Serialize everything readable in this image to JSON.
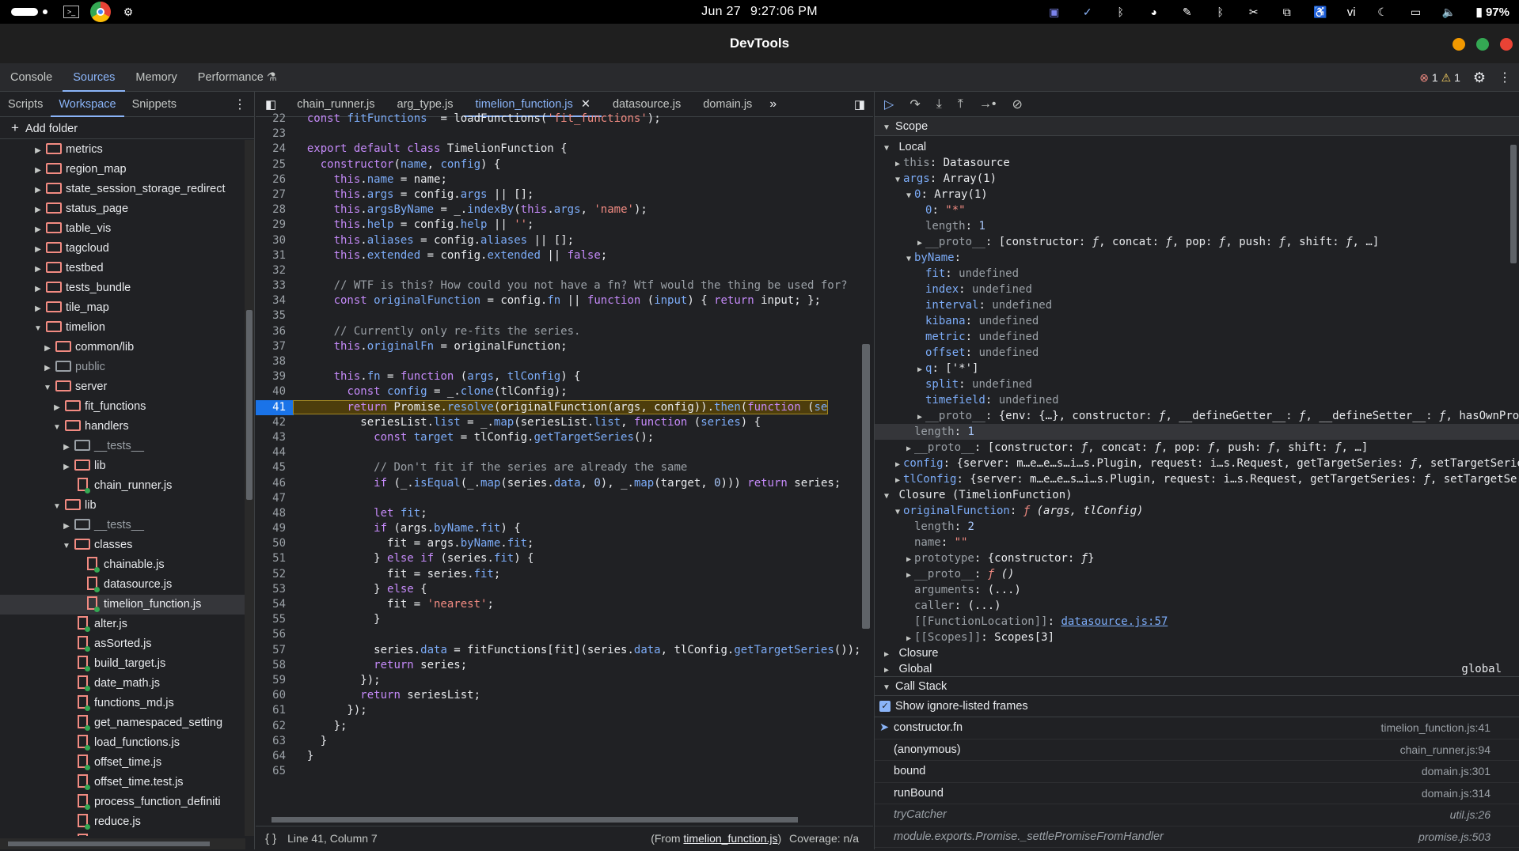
{
  "system": {
    "date": "Jun 27",
    "time": "9:27:06 PM",
    "battery": "97%",
    "lang": "vi"
  },
  "window": {
    "title": "DevTools"
  },
  "main_tabs": [
    "Console",
    "Sources",
    "Memory",
    "Performance"
  ],
  "issues": {
    "errors": "1",
    "warnings": "1"
  },
  "nav": {
    "tabs": [
      "Scripts",
      "Workspace",
      "Snippets"
    ],
    "add_folder": "Add folder",
    "tree": [
      {
        "label": "metrics",
        "type": "folder",
        "depth": 3,
        "open": false
      },
      {
        "label": "region_map",
        "type": "folder",
        "depth": 3,
        "open": false
      },
      {
        "label": "state_session_storage_redirect",
        "type": "folder",
        "depth": 3,
        "open": false
      },
      {
        "label": "status_page",
        "type": "folder",
        "depth": 3,
        "open": false
      },
      {
        "label": "table_vis",
        "type": "folder",
        "depth": 3,
        "open": false
      },
      {
        "label": "tagcloud",
        "type": "folder",
        "depth": 3,
        "open": false
      },
      {
        "label": "testbed",
        "type": "folder",
        "depth": 3,
        "open": false
      },
      {
        "label": "tests_bundle",
        "type": "folder",
        "depth": 3,
        "open": false
      },
      {
        "label": "tile_map",
        "type": "folder",
        "depth": 3,
        "open": false
      },
      {
        "label": "timelion",
        "type": "folder",
        "depth": 3,
        "open": true
      },
      {
        "label": "common/lib",
        "type": "folder",
        "depth": 4,
        "open": false
      },
      {
        "label": "public",
        "type": "folder",
        "depth": 4,
        "open": false,
        "dim": true
      },
      {
        "label": "server",
        "type": "folder",
        "depth": 4,
        "open": true
      },
      {
        "label": "fit_functions",
        "type": "folder",
        "depth": 5,
        "open": false
      },
      {
        "label": "handlers",
        "type": "folder",
        "depth": 5,
        "open": true
      },
      {
        "label": "__tests__",
        "type": "folder",
        "depth": 6,
        "open": false,
        "dim": true
      },
      {
        "label": "lib",
        "type": "folder",
        "depth": 6,
        "open": false
      },
      {
        "label": "chain_runner.js",
        "type": "file",
        "depth": 6
      },
      {
        "label": "lib",
        "type": "folder",
        "depth": 5,
        "open": true
      },
      {
        "label": "__tests__",
        "type": "folder",
        "depth": 6,
        "open": false,
        "dim": true
      },
      {
        "label": "classes",
        "type": "folder",
        "depth": 6,
        "open": true
      },
      {
        "label": "chainable.js",
        "type": "file",
        "depth": 7
      },
      {
        "label": "datasource.js",
        "type": "file",
        "depth": 7
      },
      {
        "label": "timelion_function.js",
        "type": "file",
        "depth": 7,
        "selected": true
      },
      {
        "label": "alter.js",
        "type": "file",
        "depth": 6
      },
      {
        "label": "asSorted.js",
        "type": "file",
        "depth": 6
      },
      {
        "label": "build_target.js",
        "type": "file",
        "depth": 6
      },
      {
        "label": "date_math.js",
        "type": "file",
        "depth": 6
      },
      {
        "label": "functions_md.js",
        "type": "file",
        "depth": 6
      },
      {
        "label": "get_namespaced_setting",
        "type": "file",
        "depth": 6
      },
      {
        "label": "load_functions.js",
        "type": "file",
        "depth": 6
      },
      {
        "label": "offset_time.js",
        "type": "file",
        "depth": 6
      },
      {
        "label": "offset_time.test.js",
        "type": "file",
        "depth": 6
      },
      {
        "label": "process_function_definiti",
        "type": "file",
        "depth": 6
      },
      {
        "label": "reduce.js",
        "type": "file",
        "depth": 6
      },
      {
        "label": "split_interval.js",
        "type": "file",
        "depth": 6
      }
    ]
  },
  "editor": {
    "tabs": [
      "chain_runner.js",
      "arg_type.js",
      "timelion_function.js",
      "datasource.js",
      "domain.js"
    ],
    "status": {
      "position": "Line 41, Column 7",
      "from_prefix": "(From ",
      "from_file": "timelion_function.js",
      "from_suffix": ")",
      "coverage": "Coverage: n/a"
    }
  },
  "scope": {
    "title": "Scope",
    "local": "Local",
    "closure_named": "Closure (TimelionFunction)",
    "closure": "Closure",
    "global": "Global",
    "global_val": "global"
  },
  "callstack": {
    "title": "Call Stack",
    "checkbox": "Show ignore-listed frames",
    "frames": [
      {
        "name": "constructor.fn",
        "loc": "timelion_function.js:41",
        "current": true
      },
      {
        "name": "(anonymous)",
        "loc": "chain_runner.js:94"
      },
      {
        "name": "bound",
        "loc": "domain.js:301"
      },
      {
        "name": "runBound",
        "loc": "domain.js:314"
      },
      {
        "name": "tryCatcher",
        "loc": "util.js:26",
        "ital": true
      },
      {
        "name": "module.exports.Promise._settlePromiseFromHandler",
        "loc": "promise.js:503",
        "ital": true
      }
    ]
  }
}
